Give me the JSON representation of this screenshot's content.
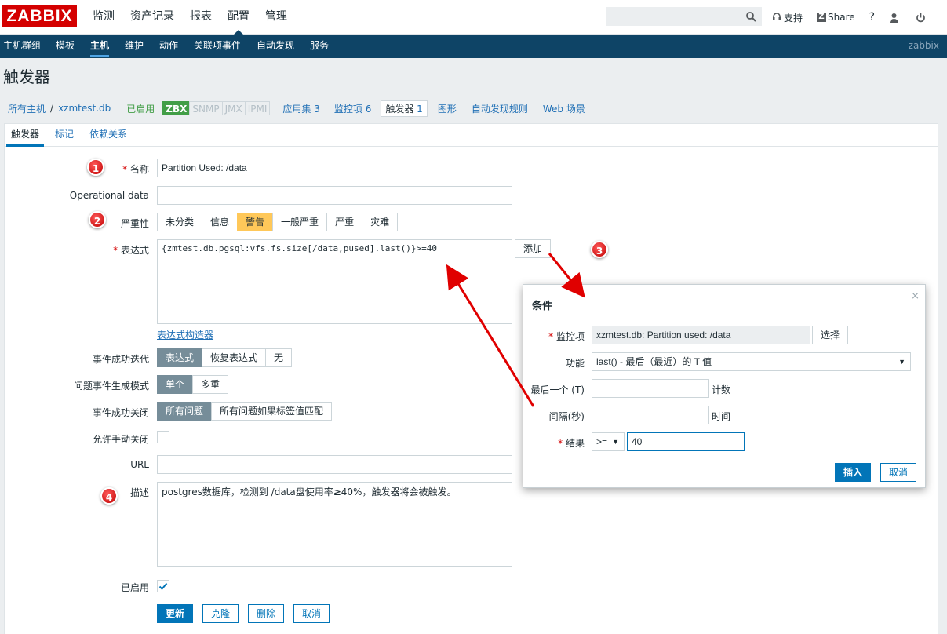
{
  "header": {
    "logo": "ZABBIX",
    "menu": [
      "监测",
      "资产记录",
      "报表",
      "配置",
      "管理"
    ],
    "active_menu": "配置",
    "search_value": "",
    "support": "支持",
    "share": "Share",
    "help": "?"
  },
  "submenu": {
    "items": [
      "主机群组",
      "模板",
      "主机",
      "维护",
      "动作",
      "关联项事件",
      "自动发现",
      "服务"
    ],
    "active": "主机",
    "user": "zabbix"
  },
  "page_title": "触发器",
  "breadcrumb": {
    "all_hosts": "所有主机",
    "sep": "/",
    "host": "xzmtest.db",
    "status": "已启用",
    "availability": [
      "ZBX",
      "SNMP",
      "JMX",
      "IPMI"
    ],
    "applications": "应用集",
    "applications_count": "3",
    "items": "监控项",
    "items_count": "6",
    "triggers": "触发器",
    "triggers_count": "1",
    "graphs": "图形",
    "discovery": "自动发现规则",
    "web": "Web 场景"
  },
  "tabs": [
    "触发器",
    "标记",
    "依赖关系"
  ],
  "form": {
    "name_label": "名称",
    "name_value": "Partition Used: /data",
    "opdata_label": "Operational data",
    "opdata_value": "",
    "severity_label": "严重性",
    "severities": [
      "未分类",
      "信息",
      "警告",
      "一般严重",
      "严重",
      "灾难"
    ],
    "severity_selected": "警告",
    "expression_label": "表达式",
    "expression_value": "{zmtest.db.pgsql:vfs.fs.size[/data,pused].last()}>=40",
    "add_button": "添加",
    "expr_constructor": "表达式构造器",
    "ok_event_label": "事件成功迭代",
    "ok_event_options": [
      "表达式",
      "恢复表达式",
      "无"
    ],
    "problem_mode_label": "问题事件生成模式",
    "problem_mode_options": [
      "单个",
      "多重"
    ],
    "ok_close_label": "事件成功关闭",
    "ok_close_options": [
      "所有问题",
      "所有问题如果标签值匹配"
    ],
    "manual_close_label": "允许手动关闭",
    "url_label": "URL",
    "url_value": "",
    "desc_label": "描述",
    "desc_value": "postgres数据库，检测到 /data盘使用率≥40%，触发器将会被触发。",
    "enabled_label": "已启用",
    "buttons": [
      "更新",
      "克隆",
      "删除",
      "取消"
    ]
  },
  "dialog": {
    "title": "条件",
    "close": "×",
    "item_label": "监控项",
    "item_value": "xzmtest.db: Partition used: /data",
    "select_button": "选择",
    "function_label": "功能",
    "function_value": "last() - 最后（最近）的 T 值",
    "last_label": "最后一个 (T)",
    "last_value": "",
    "last_unit": "计数",
    "interval_label": "间隔(秒)",
    "interval_value": "",
    "interval_unit": "时间",
    "result_label": "结果",
    "result_operator": ">=",
    "result_value": "40",
    "insert_button": "插入",
    "cancel_button": "取消"
  },
  "markers": [
    "1",
    "2",
    "3",
    "4"
  ],
  "colors": {
    "brand": "#d40000",
    "nav": "#0e4466",
    "primary": "#0275b8",
    "warning": "#ffc859",
    "enabled": "#429e47",
    "annotation": "#e00000"
  }
}
